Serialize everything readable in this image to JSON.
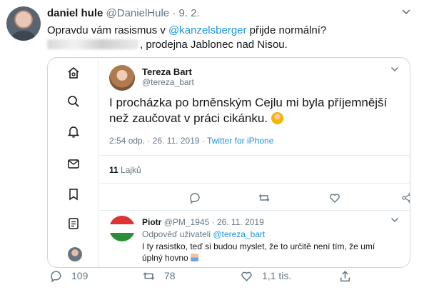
{
  "tweet": {
    "author_name": "daniel hule",
    "author_handle": "@DanielHule",
    "separator": "·",
    "date": "9. 2.",
    "text_before": "Opravdu vám rasismus v ",
    "mention": "@kanzelsberger",
    "text_after": " přijde normální?",
    "line2_visible": ", prodejna Jablonec nad Nisou.",
    "actions": {
      "reply_count": "109",
      "retweet_count": "78",
      "like_count": "1,1 tis."
    }
  },
  "embedded": {
    "author_name": "Tereza Bart",
    "author_handle": "@tereza_bart",
    "text": "I procházka po brněnským Cejlu mi byla příjemnější než zaučovat v práci cikánku.",
    "meta_time": "2:54 odp. · 26. 11. 2019 · ",
    "meta_source": "Twitter for iPhone",
    "likes_count": "11",
    "likes_label": "Lajků",
    "reply": {
      "author_name": "Piotr",
      "author_handle": "@PM_1945",
      "separator": "·",
      "date": "26. 11. 2019",
      "reply_to_label": "Odpověď uživateli ",
      "reply_to_handle": "@tereza_bart",
      "text": "I ty rasistko, teď si budou myslet, že to určitě není tím, že umí úplný hovno"
    }
  },
  "colors": {
    "accent": "#1b95e0",
    "muted": "#657786",
    "text": "#14171a",
    "border": "#ccd6dd"
  },
  "icons": [
    "home-icon",
    "explore-icon",
    "notifications-icon",
    "messages-icon",
    "bookmarks-icon",
    "lists-icon",
    "reply-icon",
    "retweet-icon",
    "like-icon",
    "share-icon",
    "chevron-down-icon"
  ]
}
